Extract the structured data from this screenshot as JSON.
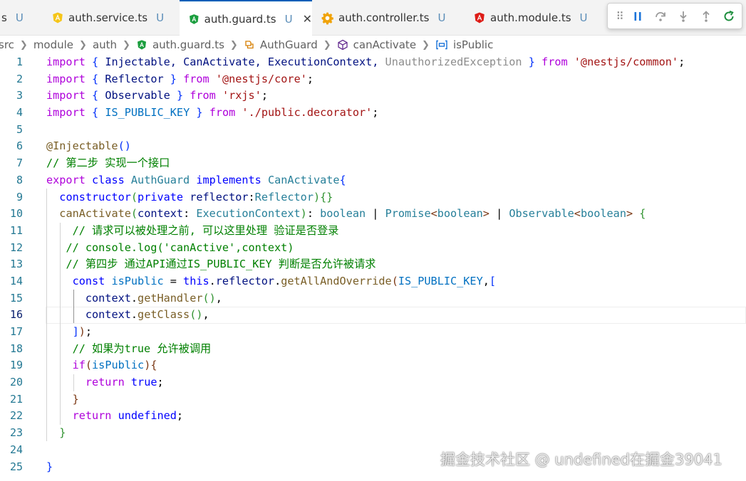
{
  "tabs": [
    {
      "name": "s",
      "status": "U"
    },
    {
      "name": "auth.service.ts",
      "status": "U"
    },
    {
      "name": "auth.guard.ts",
      "status": "U",
      "active": true
    },
    {
      "name": "auth.controller.ts",
      "status": "U"
    },
    {
      "name": "auth.module.ts",
      "status": "U"
    }
  ],
  "tab_close_glyph": "✕",
  "debug_toolbar": {
    "grip": "⠿",
    "buttons": [
      "pause",
      "step-over",
      "step-into",
      "step-out",
      "restart"
    ]
  },
  "breadcrumb": [
    "src",
    "module",
    "auth",
    "auth.guard.ts",
    "AuthGuard",
    "canActivate",
    "isPublic"
  ],
  "line_numbers": [
    "1",
    "2",
    "3",
    "4",
    "5",
    "6",
    "7",
    "8",
    "9",
    "10",
    "11",
    "12",
    "13",
    "14",
    "15",
    "16",
    "17",
    "18",
    "19",
    "20",
    "21",
    "22",
    "23",
    "24",
    "25"
  ],
  "current_line": 16,
  "code": {
    "l1": {
      "import": "import",
      "names": "Injectable, CanActivate, ExecutionContext,",
      "unused": "UnauthorizedException",
      "from": "from",
      "path": "'@nestjs/common'"
    },
    "l2": {
      "import": "import",
      "names": "Reflector",
      "from": "from",
      "path": "'@nestjs/core'"
    },
    "l3": {
      "import": "import",
      "names": "Observable",
      "from": "from",
      "path": "'rxjs'"
    },
    "l4": {
      "import": "import",
      "names": "IS_PUBLIC_KEY",
      "from": "from",
      "path": "'./public.decorator'"
    },
    "l6": {
      "decorator": "@Injectable"
    },
    "l7": {
      "comment": "// 第二步 实现一个接口"
    },
    "l8": {
      "export": "export",
      "class": "class",
      "name": "AuthGuard",
      "implements": "implements",
      "iface": "CanActivate"
    },
    "l9": {
      "ctor": "constructor",
      "private": "private",
      "param": "reflector",
      "type": "Reflector"
    },
    "l10": {
      "fn": "canActivate",
      "param": "context",
      "ptype": "ExecutionContext",
      "rt1": "boolean",
      "rt2": "Promise",
      "rt3": "boolean",
      "rt4": "Observable",
      "rt5": "boolean"
    },
    "l11": {
      "comment": "// 请求可以被处理之前, 可以这里处理 验证是否登录"
    },
    "l12": {
      "comment": "// console.log('canActive',context)"
    },
    "l13": {
      "comment": "// 第四步 通过API通过IS_PUBLIC_KEY 判断是否允许被请求"
    },
    "l14": {
      "const": "const",
      "var": "isPublic",
      "this": "this",
      "prop": "reflector",
      "method": "getAllAndOverride",
      "key": "IS_PUBLIC_KEY"
    },
    "l15": {
      "obj": "context",
      "method": "getHandler"
    },
    "l16": {
      "obj": "context",
      "method": "getClass"
    },
    "l18": {
      "comment": "// 如果为true 允许被调用"
    },
    "l19": {
      "if": "if",
      "var": "isPublic"
    },
    "l20": {
      "return": "return",
      "value": "true"
    },
    "l22": {
      "return": "return",
      "value": "undefined"
    }
  },
  "watermark": "掘金技术社区 @ undefined在掘金39041"
}
